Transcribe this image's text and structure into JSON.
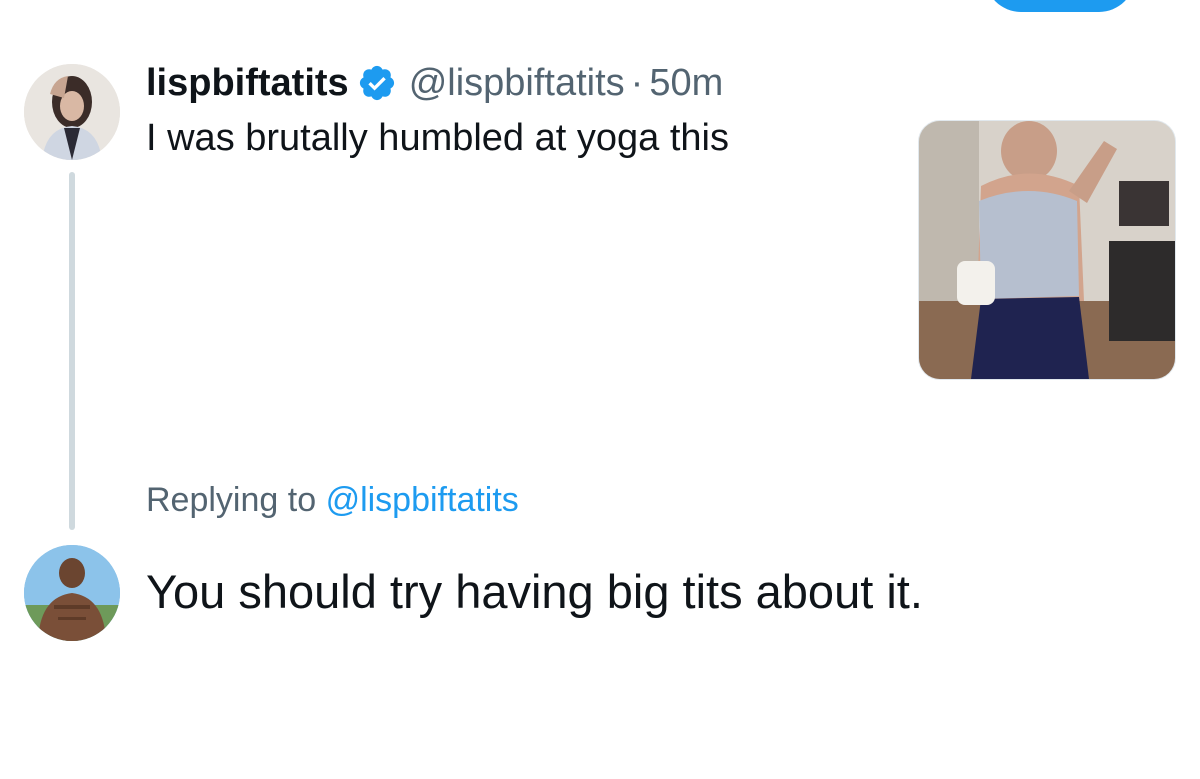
{
  "original_tweet": {
    "display_name": "lispbiftatits",
    "handle": "@lispbiftatits",
    "separator": "·",
    "time": "50m",
    "text": "I was brutally humbled at yoga this",
    "verified": true
  },
  "reply": {
    "replying_label": "Replying to",
    "replying_handle": "@lispbiftatits",
    "text": "You should try having big tits about it."
  },
  "colors": {
    "accent": "#1d9bf0",
    "text_primary": "#0f1419",
    "text_secondary": "#536471",
    "thread_line": "#cfd9de"
  }
}
